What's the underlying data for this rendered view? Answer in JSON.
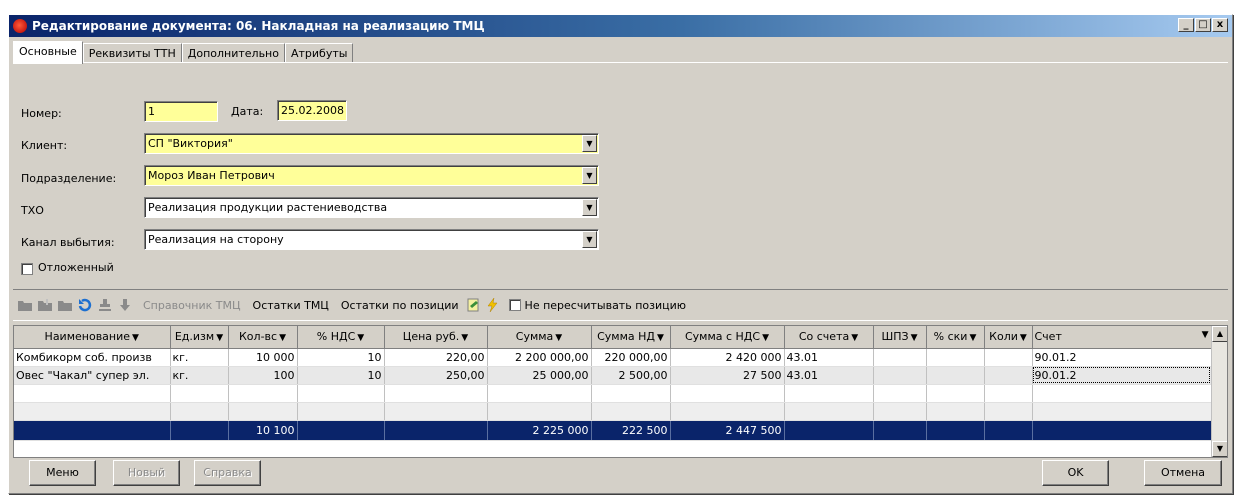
{
  "window": {
    "title": "Редактирование документа: 06. Накладная на реализацию ТМЦ",
    "controls": [
      "_",
      "□",
      "x"
    ]
  },
  "tabs": [
    "Основные",
    "Реквизиты ТТН",
    "Дополнительно",
    "Атрибуты"
  ],
  "form": {
    "number_label": "Номер:",
    "number_value": "1",
    "date_label": "Дата:",
    "date_value": "25.02.2008",
    "client_label": "Клиент:",
    "client_value": "СП \"Виктория\"",
    "division_label": "Подразделение:",
    "division_value": "Мороз  Иван  Петрович",
    "txo_label": "ТХО",
    "txo_value": "Реализация продукции растениеводства",
    "channel_label": "Канал выбытия:",
    "channel_value": "Реализация на сторону",
    "deferred_label": "Отложенный"
  },
  "toolbar": {
    "reference_label": "Справочник ТМЦ",
    "stock_label": "Остатки ТМЦ",
    "stock_position_label": "Остатки по позиции",
    "no_recalc_label": "Не пересчитывать позицию"
  },
  "grid": {
    "columns": [
      "Наименование",
      "Ед.изм",
      "Кол-вс",
      "% НДС",
      "Цена руб.",
      "Сумма",
      "Сумма НД",
      "Сумма с НДС",
      "Со счета",
      "ШПЗ",
      "% ски",
      "Коли",
      "Счет"
    ],
    "rows": [
      [
        "Комбикорм соб. произв",
        "кг.",
        "10 000",
        "10",
        "220,00",
        "2 200 000,00",
        "220 000,00",
        "2 420 000",
        "43.01",
        "",
        "",
        "",
        "90.01.2"
      ],
      [
        "Овес \"Чакал\" супер эл.",
        "кг.",
        "100",
        "10",
        "250,00",
        "25 000,00",
        "2 500,00",
        "27 500",
        "43.01",
        "",
        "",
        "",
        "90.01.2"
      ]
    ],
    "totals": [
      "",
      "",
      "10 100",
      "",
      "",
      "2 225 000",
      "222 500",
      "2 447 500",
      "",
      "",
      "",
      "",
      ""
    ]
  },
  "buttons": {
    "menu": "Меню",
    "new": "Новый",
    "help": "Справка",
    "ok": "OK",
    "cancel": "Отмена"
  }
}
